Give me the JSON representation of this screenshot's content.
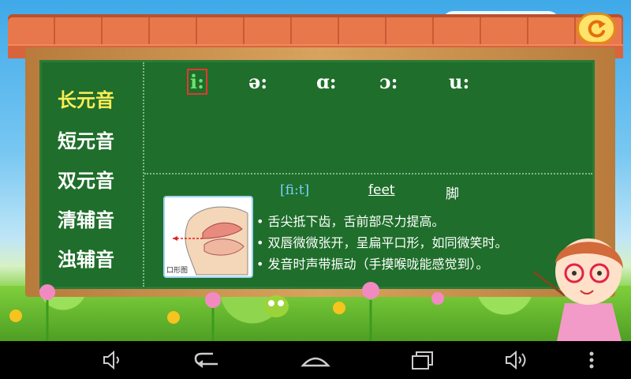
{
  "back_button_icon": "return-arrow-icon",
  "sidebar": {
    "items": [
      {
        "label": "长元音",
        "active": true
      },
      {
        "label": "短元音",
        "active": false
      },
      {
        "label": "双元音",
        "active": false
      },
      {
        "label": "清辅音",
        "active": false
      },
      {
        "label": "浊辅音",
        "active": false
      }
    ]
  },
  "symbols": [
    "i:",
    "ə:",
    "ɑ:",
    "ɔ:",
    "u:"
  ],
  "selected_symbol": "i:",
  "example": {
    "phonetic": "[fi:t]",
    "word": "feet",
    "meaning": "脚"
  },
  "diagram_caption": "口形图",
  "tips": [
    "舌尖抵下齿，舌前部尽力提高。",
    "双唇微微张开，呈扁平口形，如同微笑时。",
    "发音时声带振动（手摸喉咙能感觉到）。"
  ],
  "nav_icons": [
    "volume-down-icon",
    "back-icon",
    "home-icon",
    "recent-apps-icon",
    "volume-up-icon",
    "menu-icon"
  ],
  "colors": {
    "board": "#1f6e2b",
    "active_menu": "#ffee55",
    "phonetic": "#7ad0ff"
  }
}
